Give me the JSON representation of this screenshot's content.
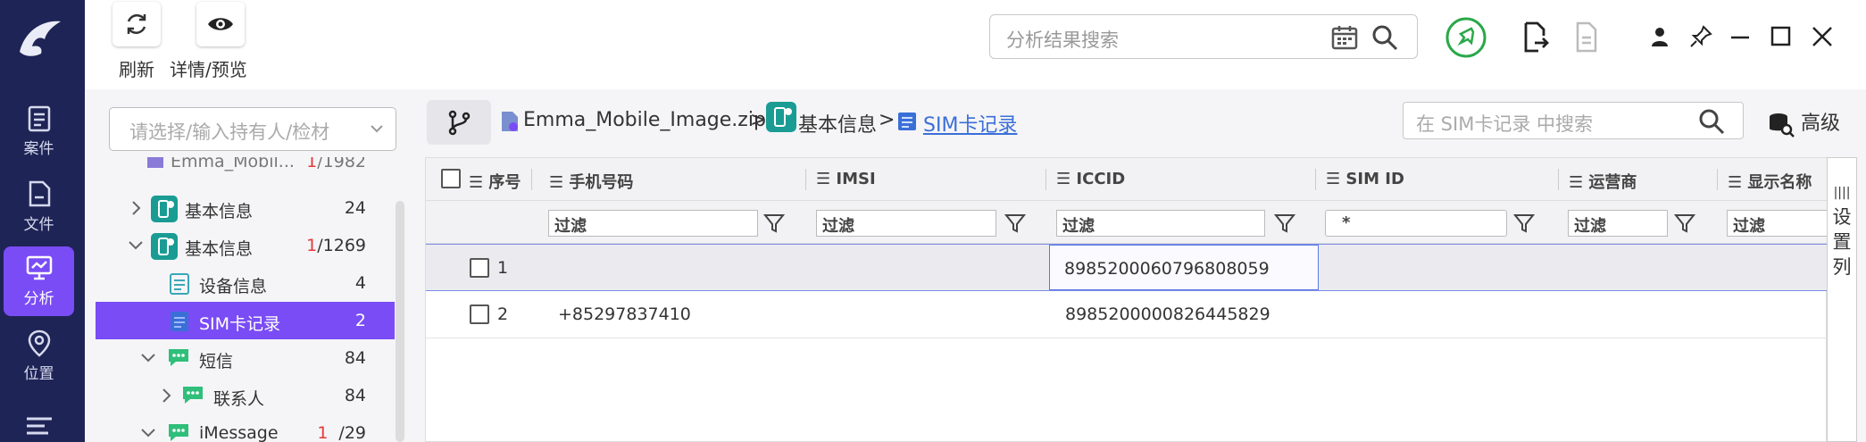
{
  "toolbar": {
    "refresh_label": "刷新",
    "details_label": "详情/预览",
    "search_placeholder": "分析结果搜索"
  },
  "rail": {
    "items": [
      {
        "label": "案件"
      },
      {
        "label": "文件"
      },
      {
        "label": "分析"
      },
      {
        "label": "位置"
      }
    ]
  },
  "sidebar": {
    "select_placeholder": "请选择/输入持有人/检材",
    "tree": [
      {
        "label": "Emma_Mobil...",
        "count": "/1982",
        "red": "1"
      },
      {
        "label": "基本信息",
        "count": "24",
        "red": ""
      },
      {
        "label": "基本信息",
        "count": "/1269",
        "red": "1"
      },
      {
        "label": "设备信息",
        "count": "4",
        "red": ""
      },
      {
        "label": "SIM卡记录",
        "count": "2",
        "red": ""
      },
      {
        "label": "短信",
        "count": "84",
        "red": ""
      },
      {
        "label": "联系人",
        "count": "84",
        "red": ""
      },
      {
        "label": "iMessage",
        "count": "/29",
        "red": "1"
      }
    ]
  },
  "breadcrumb": {
    "file": "Emma_Mobile_Image.zip",
    "basic": "基本信息",
    "current": "SIM卡记录",
    "sep": ">"
  },
  "inner_search": {
    "placeholder": "在 SIM卡记录 中搜索",
    "advanced_label": "高级"
  },
  "grid": {
    "columns": [
      "序号",
      "手机号码",
      "IMSI",
      "ICCID",
      "SIM ID",
      "运营商",
      "显示名称"
    ],
    "filter_placeholder": "过滤",
    "simid_filter": "*",
    "rows": [
      {
        "index": "1",
        "phone": "",
        "imsi": "",
        "iccid": "8985200060796808059",
        "simid": ""
      },
      {
        "index": "2",
        "phone": "+85297837410",
        "imsi": "",
        "iccid": "8985200000826445829",
        "simid": ""
      }
    ],
    "settings_label": "设置列"
  },
  "colors": {
    "rail_bg": "#1e2455",
    "accent": "#7a4cf5",
    "link": "#3b6fd8",
    "green": "#2aa84a"
  }
}
